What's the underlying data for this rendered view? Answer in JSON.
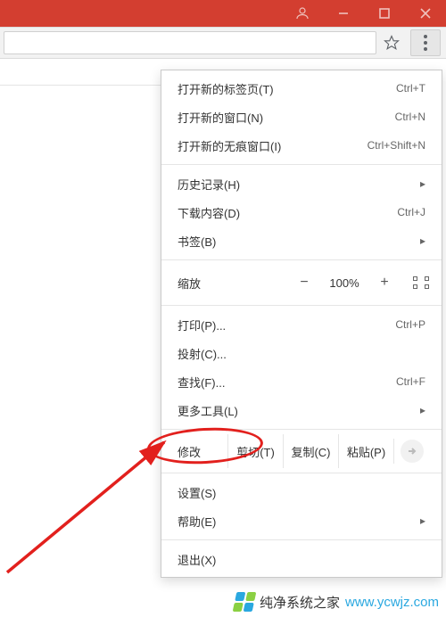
{
  "menu": {
    "new_tab": {
      "label": "打开新的标签页(T)",
      "shortcut": "Ctrl+T"
    },
    "new_window": {
      "label": "打开新的窗口(N)",
      "shortcut": "Ctrl+N"
    },
    "new_incognito": {
      "label": "打开新的无痕窗口(I)",
      "shortcut": "Ctrl+Shift+N"
    },
    "history": {
      "label": "历史记录(H)"
    },
    "downloads": {
      "label": "下载内容(D)",
      "shortcut": "Ctrl+J"
    },
    "bookmarks": {
      "label": "书签(B)"
    },
    "zoom": {
      "label": "缩放",
      "minus": "−",
      "value": "100%",
      "plus": "+"
    },
    "print": {
      "label": "打印(P)...",
      "shortcut": "Ctrl+P"
    },
    "cast": {
      "label": "投射(C)..."
    },
    "find": {
      "label": "查找(F)...",
      "shortcut": "Ctrl+F"
    },
    "more_tools": {
      "label": "更多工具(L)"
    },
    "edit": {
      "label": "修改",
      "cut": "剪切(T)",
      "copy": "复制(C)",
      "paste": "粘贴(P)"
    },
    "settings": {
      "label": "设置(S)"
    },
    "help": {
      "label": "帮助(E)"
    },
    "exit": {
      "label": "退出(X)"
    }
  },
  "watermark": {
    "text": "纯净系统之家",
    "suffix": "www.ycwjz.com"
  }
}
